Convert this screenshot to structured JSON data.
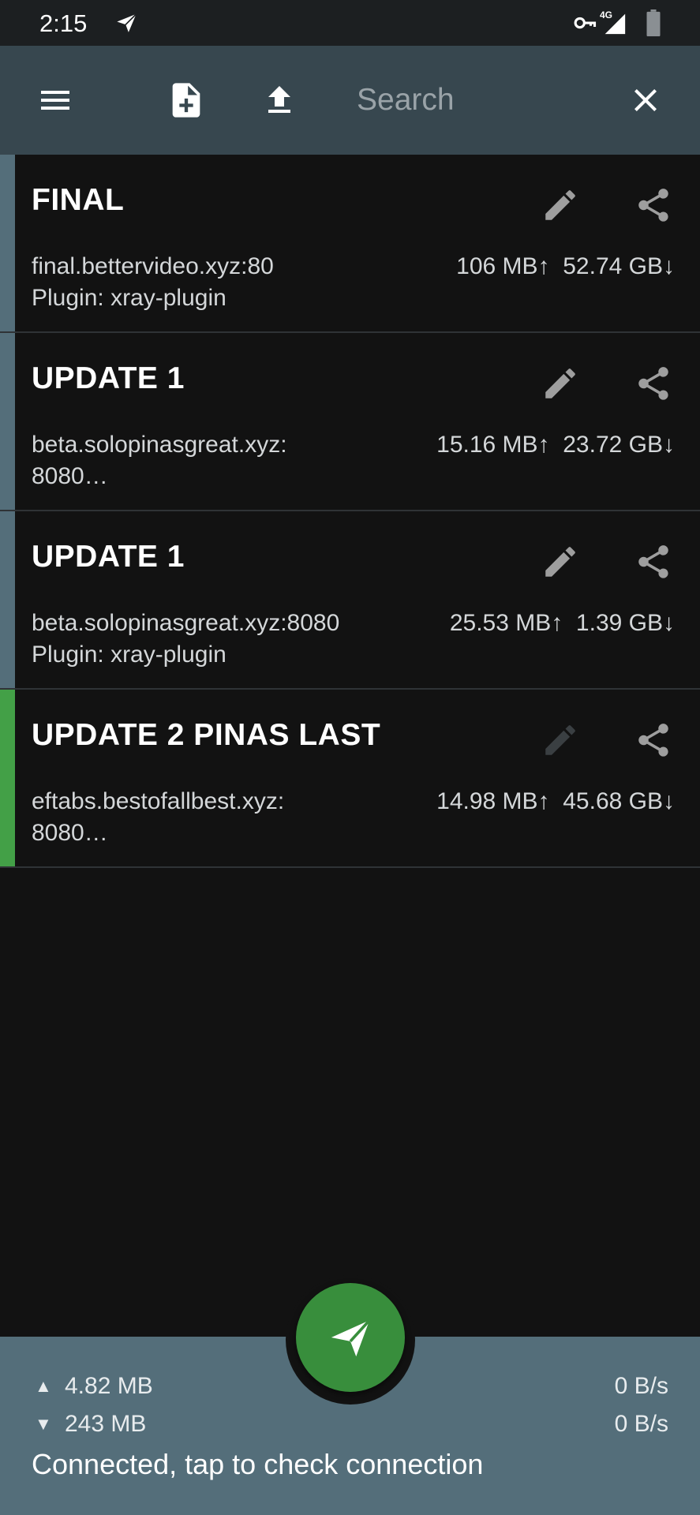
{
  "status_bar": {
    "time": "2:15",
    "network": "4G",
    "icons": [
      "send-icon",
      "vpn-key-icon",
      "network-signal-icon",
      "battery-icon"
    ]
  },
  "toolbar": {
    "search_placeholder": "Search",
    "icons": [
      "menu-icon",
      "note-add-icon",
      "upload-icon",
      "close-icon"
    ]
  },
  "profiles": [
    {
      "name": "FINAL",
      "address_line1": "final.bettervideo.xyz:80",
      "address_line2": "Plugin: xray-plugin",
      "upload": "106 MB↑",
      "download": "52.74 GB↓",
      "selected": false
    },
    {
      "name": "UPDATE 1",
      "address_line1": "beta.solopinasgreat.xyz:",
      "address_line2": "8080…",
      "upload": "15.16 MB↑",
      "download": "23.72 GB↓",
      "selected": false
    },
    {
      "name": "UPDATE 1",
      "address_line1": "beta.solopinasgreat.xyz:8080",
      "address_line2": "Plugin: xray-plugin",
      "upload": "25.53 MB↑",
      "download": "1.39 GB↓",
      "selected": false
    },
    {
      "name": "UPDATE 2 PINAS LAST",
      "address_line1": "eftabs.bestofallbest.xyz:",
      "address_line2": "8080…",
      "upload": "14.98 MB↑",
      "download": "45.68 GB↓",
      "selected": true
    }
  ],
  "bottom_bar": {
    "tx_arrow": "▲",
    "rx_arrow": "▼",
    "tx_total": "4.82 MB",
    "rx_total": "243 MB",
    "tx_rate": "0 B/s",
    "rx_rate": "0 B/s",
    "status": "Connected, tap to check connection"
  },
  "colors": {
    "toolbar": "#37474f",
    "bottom_bar": "#546e7a",
    "fab": "#388e3c",
    "selected_indicator": "#43a047",
    "unselected_indicator": "#546e7a",
    "background": "#121212"
  }
}
